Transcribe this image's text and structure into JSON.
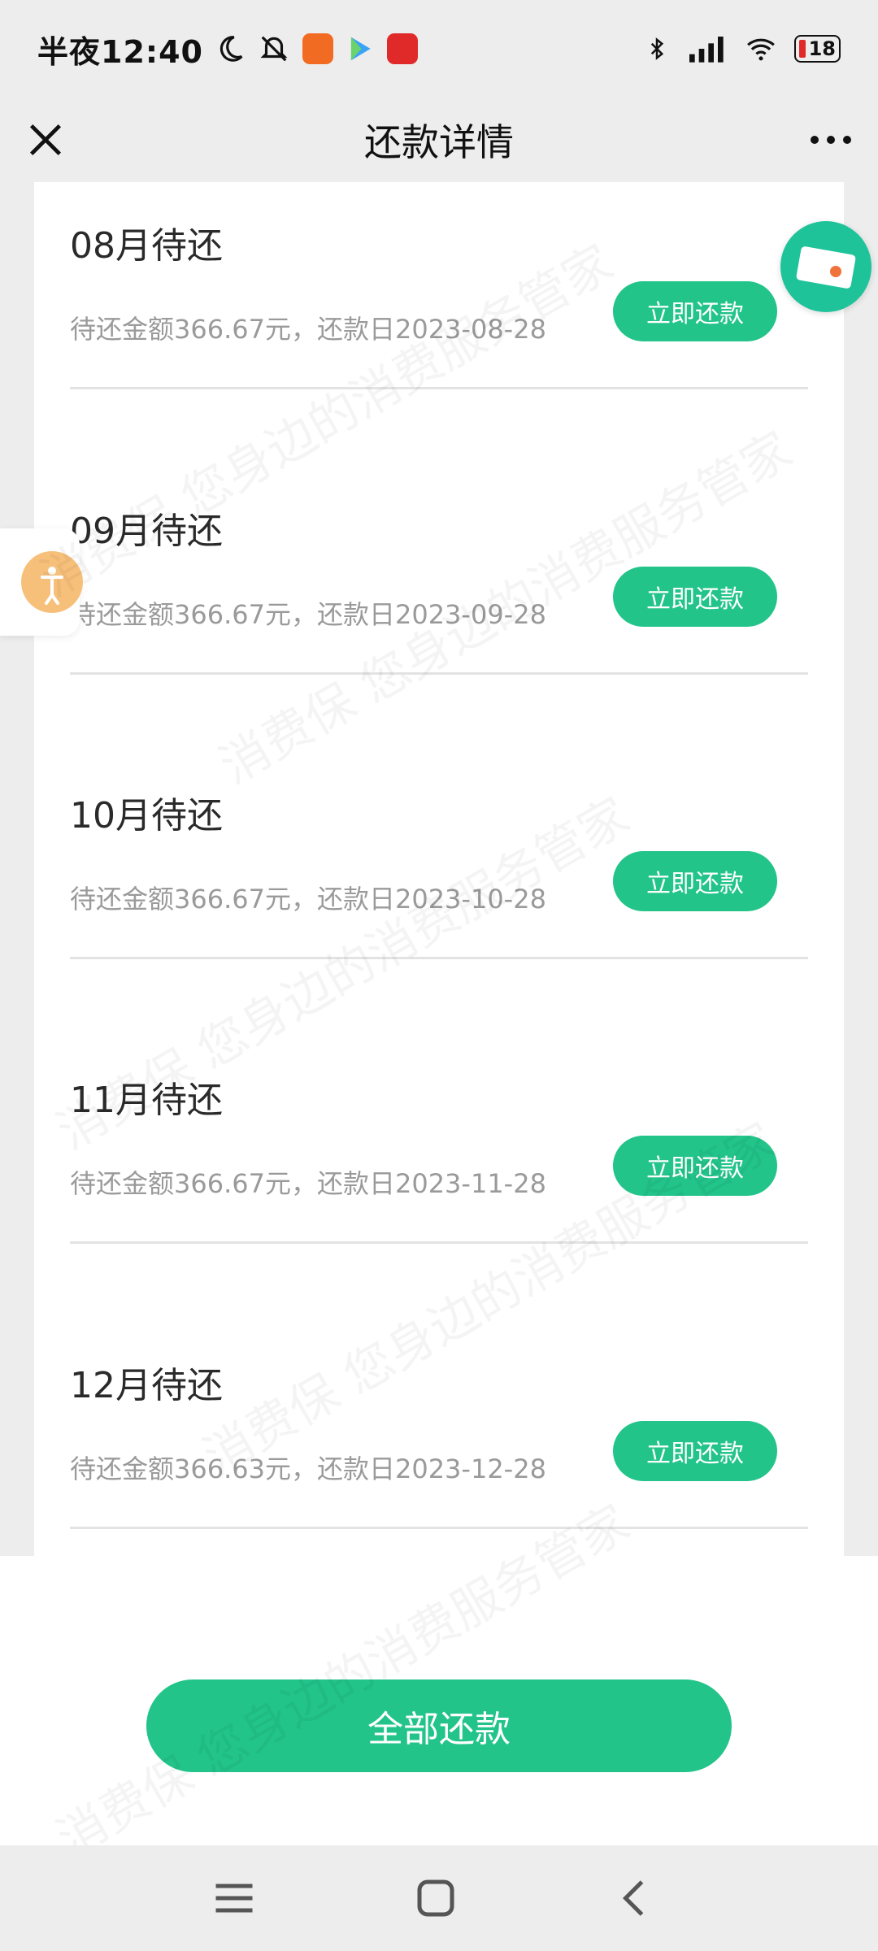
{
  "status_bar": {
    "time": "半夜12:40",
    "battery": "18"
  },
  "header": {
    "title": "还款详情"
  },
  "installments": [
    {
      "title": "08月待还",
      "detail": "待还金额366.67元，还款日2023-08-28",
      "button": "立即还款"
    },
    {
      "title": "09月待还",
      "detail": "待还金额366.67元，还款日2023-09-28",
      "button": "立即还款"
    },
    {
      "title": "10月待还",
      "detail": "待还金额366.67元，还款日2023-10-28",
      "button": "立即还款"
    },
    {
      "title": "11月待还",
      "detail": "待还金额366.67元，还款日2023-11-28",
      "button": "立即还款"
    },
    {
      "title": "12月待还",
      "detail": "待还金额366.63元，还款日2023-12-28",
      "button": "立即还款"
    }
  ],
  "footer": {
    "pay_all_label": "全部还款"
  },
  "watermark": "消费保 您身边的消费服务管家",
  "colors": {
    "accent": "#22c48a",
    "background": "#ededed",
    "card": "#ffffff"
  }
}
